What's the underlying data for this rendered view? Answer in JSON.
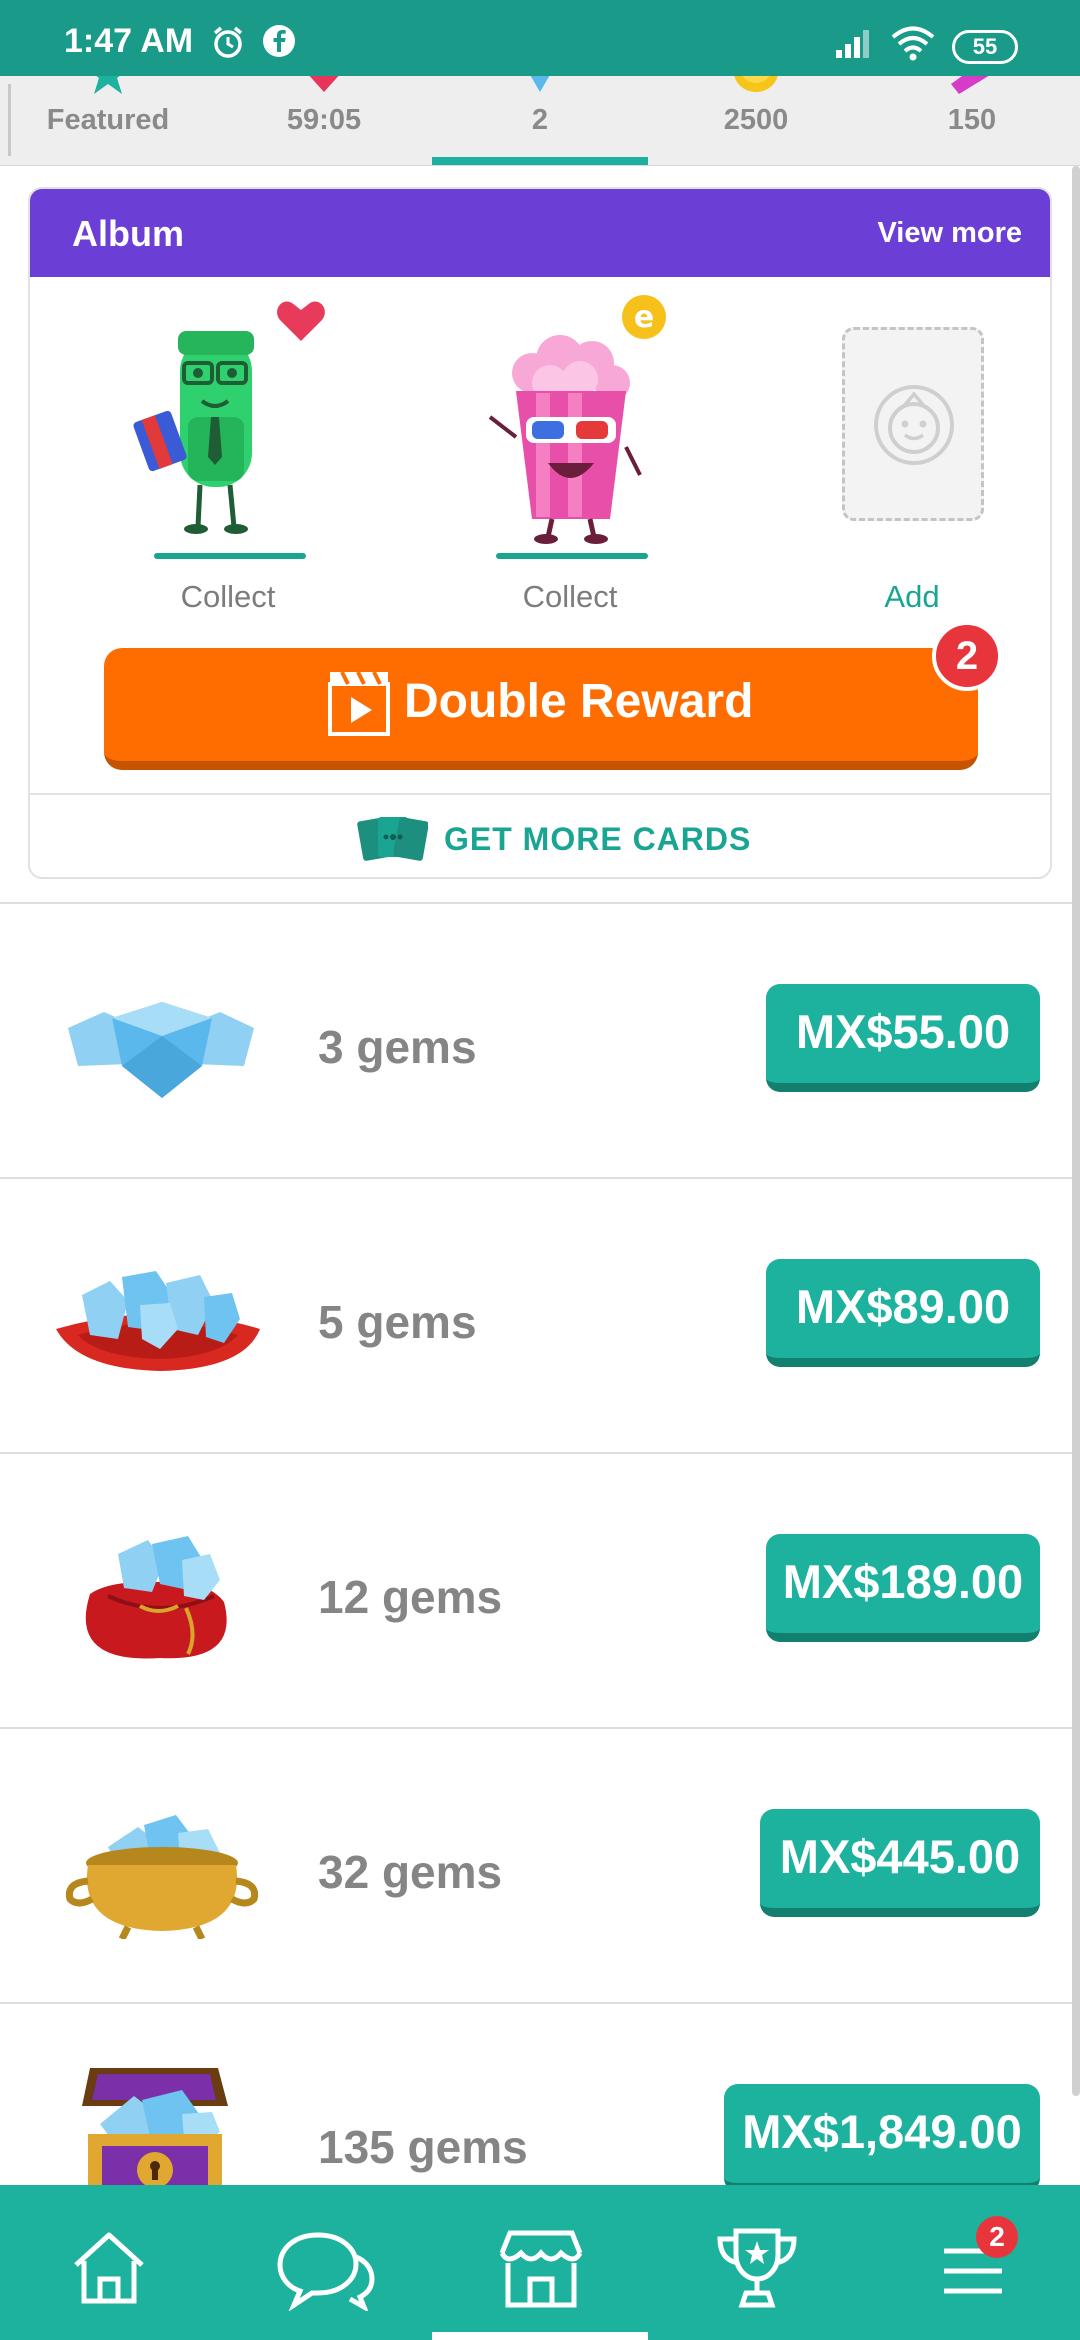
{
  "status_bar": {
    "time": "1:47 AM",
    "battery": "55",
    "icons": [
      "alarm-icon",
      "facebook-icon",
      "signal-icon",
      "wifi-icon",
      "battery-icon"
    ]
  },
  "tabs": [
    {
      "label": "Featured",
      "icon": "star-icon",
      "active": false
    },
    {
      "label": "59:05",
      "icon": "heart-icon",
      "active": false
    },
    {
      "label": "2",
      "icon": "gem-icon",
      "active": true
    },
    {
      "label": "2500",
      "icon": "coin-icon",
      "active": false
    },
    {
      "label": "150",
      "icon": "ticket-icon",
      "active": false
    }
  ],
  "album": {
    "title": "Album",
    "view_more": "View more",
    "slots": [
      {
        "label": "Collect",
        "icon": "green-test-tube-character"
      },
      {
        "label": "Collect",
        "icon": "popcorn-character"
      },
      {
        "label": "Add",
        "icon": "empty-card-slot"
      }
    ],
    "double_reward": {
      "label": "Double Reward",
      "badge": "2"
    },
    "get_more_cards": "GET MORE CARDS"
  },
  "gems": [
    {
      "label": "3 gems",
      "price": "MX$55.00",
      "icon": "three-gems"
    },
    {
      "label": "5 gems",
      "price": "MX$89.00",
      "icon": "gems-on-cushion"
    },
    {
      "label": "12 gems",
      "price": "MX$189.00",
      "icon": "gem-sack"
    },
    {
      "label": "32 gems",
      "price": "MX$445.00",
      "icon": "gem-pot"
    },
    {
      "label": "135 gems",
      "price": "MX$1,849.00",
      "icon": "gem-chest"
    }
  ],
  "bottom_nav": {
    "items": [
      "home-icon",
      "chat-icon",
      "shop-icon",
      "trophy-icon",
      "menu-icon"
    ],
    "menu_badge": "2"
  },
  "colors": {
    "teal": "#1db29e",
    "purple": "#6b3fd6",
    "orange": "#ff6d00",
    "badge_red": "#e8343b"
  }
}
